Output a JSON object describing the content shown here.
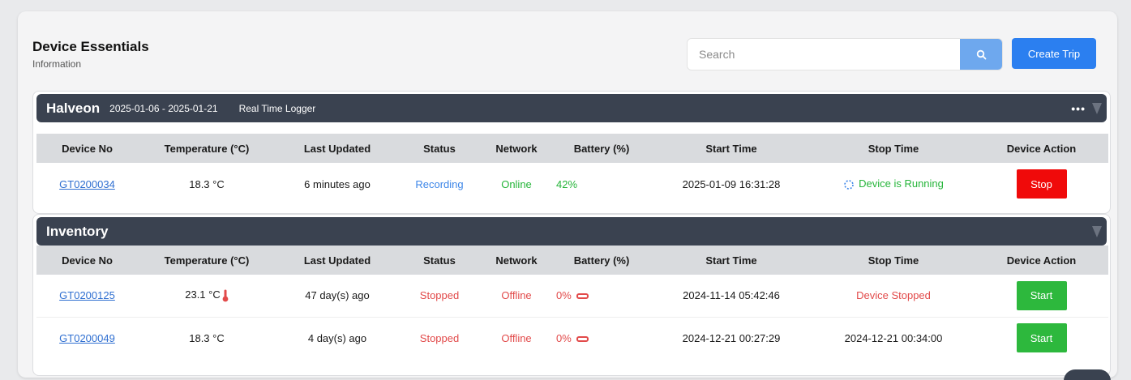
{
  "header": {
    "title": "Device Essentials",
    "subtitle": "Information"
  },
  "search": {
    "placeholder": "Search"
  },
  "actions": {
    "create_trip": "Create Trip"
  },
  "columns": [
    "Device No",
    "Temperature (°C)",
    "Last Updated",
    "Status",
    "Network",
    "Battery (%)",
    "Start Time",
    "Stop Time",
    "Device Action"
  ],
  "groups": [
    {
      "name": "Halveon",
      "date_range": "2025-01-06 - 2025-01-21",
      "type": "Real Time Logger",
      "rows": [
        {
          "device_no": "GT0200034",
          "temperature": "18.3 °C",
          "last_updated": "6 minutes ago",
          "status": "Recording",
          "network": "Online",
          "battery": "42%",
          "start_time": "2025-01-09 16:31:28",
          "stop_time": "Device is Running",
          "action": "Stop"
        }
      ]
    },
    {
      "name": "Inventory",
      "rows": [
        {
          "device_no": "GT0200125",
          "temperature": "23.1 °C",
          "last_updated": "47 day(s) ago",
          "status": "Stopped",
          "network": "Offline",
          "battery": "0%",
          "start_time": "2024-11-14 05:42:46",
          "stop_time": "Device Stopped",
          "action": "Start"
        },
        {
          "device_no": "GT0200049",
          "temperature": "18.3 °C",
          "last_updated": "4 day(s) ago",
          "status": "Stopped",
          "network": "Offline",
          "battery": "0%",
          "start_time": "2024-12-21 00:27:29",
          "stop_time": "2024-12-21 00:34:00",
          "action": "Start"
        }
      ]
    }
  ],
  "icons": {
    "search": "search-icon",
    "more": "more-dots-icon",
    "filter": "filter-icon",
    "thermometer": "thermometer-icon",
    "battery": "battery-empty-icon",
    "spinner": "spinner-icon"
  },
  "colors": {
    "accent": "#2b7ff0",
    "recording": "#3d86e8",
    "online": "#26b53a",
    "stopped": "#e24a4a",
    "stop_button": "#f00a0a",
    "start_button": "#2db83d",
    "group_bar": "#3a4250"
  }
}
